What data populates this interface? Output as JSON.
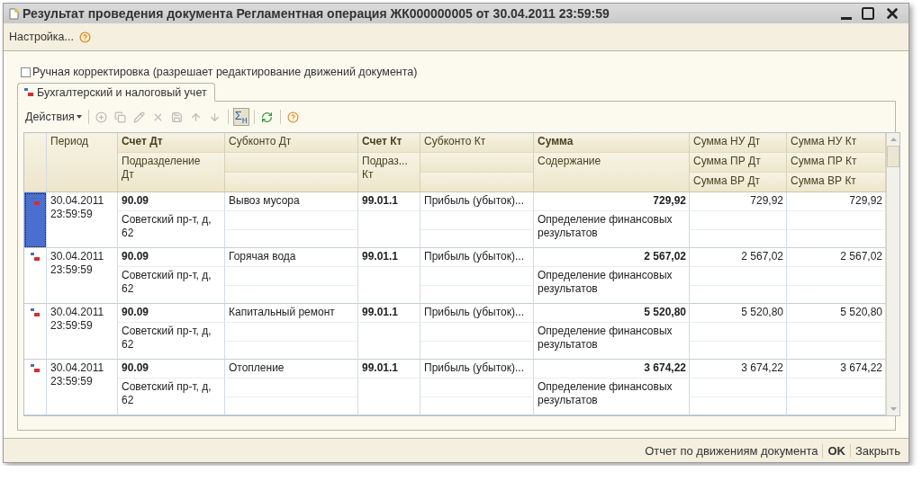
{
  "window": {
    "title": "Результат проведения документа Регламентная операция ЖК000000005 от 30.04.2011 23:59:59"
  },
  "menu": {
    "settings": "Настройка..."
  },
  "manual_correction": {
    "label": "Ручная корректировка (разрешает редактирование движений документа)",
    "checked": false
  },
  "tabs": [
    {
      "label": "Бухгалтерский и налоговый учет",
      "selected": true
    }
  ],
  "toolbar": {
    "actions": "Действия",
    "buttons": [
      {
        "kind": "add",
        "disabled": true,
        "pressed": false
      },
      {
        "kind": "copy",
        "disabled": true,
        "pressed": false
      },
      {
        "kind": "edit",
        "disabled": true,
        "pressed": false
      },
      {
        "kind": "delete",
        "disabled": true,
        "pressed": false
      },
      {
        "kind": "save",
        "disabled": true,
        "pressed": false
      },
      {
        "kind": "up",
        "disabled": true,
        "pressed": false
      },
      {
        "kind": "down",
        "disabled": true,
        "pressed": false
      },
      {
        "kind": "sum",
        "label": "Σ$_{н}$",
        "disabled": false,
        "pressed": true
      },
      {
        "kind": "refresh",
        "disabled": false,
        "pressed": false
      },
      {
        "kind": "help",
        "disabled": false,
        "pressed": false
      }
    ]
  },
  "table": {
    "columns": [
      {
        "kind": "span",
        "lines": [
          "Период"
        ]
      },
      {
        "kind": "pair",
        "bold": true,
        "lines": [
          "Счет Дт",
          "Подразделение\nДт"
        ]
      },
      {
        "kind": "triple",
        "lines": [
          "Субконто Дт"
        ]
      },
      {
        "kind": "pair",
        "bold": true,
        "lines": [
          "Счет Кт",
          "Подраз...\nКт"
        ]
      },
      {
        "kind": "triple",
        "lines": [
          "Субконто Кт"
        ]
      },
      {
        "kind": "pair",
        "bold": true,
        "numeric": true,
        "lines": [
          "Сумма",
          "Содержание"
        ]
      },
      {
        "kind": "triple",
        "numeric": true,
        "lines": [
          "Сумма НУ Дт",
          "Сумма ПР Дт",
          "Сумма ВР Дт"
        ]
      },
      {
        "kind": "triple",
        "numeric": true,
        "lines": [
          "Сумма НУ Кт",
          "Сумма ПР Кт",
          "Сумма ВР Кт"
        ]
      }
    ],
    "rows": [
      {
        "selected": true,
        "cells": [
          [
            "30.04.2011 23:59:59"
          ],
          [
            "90.09",
            "Советский пр-т, д, 62"
          ],
          [
            "Вывоз мусора"
          ],
          [
            "99.01.1"
          ],
          [
            "Прибыль (убыток)..."
          ],
          [
            "729,92",
            "Определение финансовых результатов"
          ],
          [
            "729,92"
          ],
          [
            "729,92"
          ]
        ]
      },
      {
        "selected": false,
        "cells": [
          [
            "30.04.2011 23:59:59"
          ],
          [
            "90.09",
            "Советский пр-т, д, 62"
          ],
          [
            "Горячая вода"
          ],
          [
            "99.01.1"
          ],
          [
            "Прибыль (убыток)..."
          ],
          [
            "2 567,02",
            "Определение финансовых результатов"
          ],
          [
            "2 567,02"
          ],
          [
            "2 567,02"
          ]
        ]
      },
      {
        "selected": false,
        "cells": [
          [
            "30.04.2011 23:59:59"
          ],
          [
            "90.09",
            "Советский пр-т, д, 62"
          ],
          [
            "Капитальный ремонт"
          ],
          [
            "99.01.1"
          ],
          [
            "Прибыль (убыток)..."
          ],
          [
            "5 520,80",
            "Определение финансовых результатов"
          ],
          [
            "5 520,80"
          ],
          [
            "5 520,80"
          ]
        ]
      },
      {
        "selected": false,
        "cells": [
          [
            "30.04.2011 23:59:59"
          ],
          [
            "90.09",
            "Советский пр-т, д, 62"
          ],
          [
            "Отопление"
          ],
          [
            "99.01.1"
          ],
          [
            "Прибыль (убыток)..."
          ],
          [
            "3 674,22",
            "Определение финансовых результатов"
          ],
          [
            "3 674,22"
          ],
          [
            "3 674,22"
          ]
        ]
      }
    ]
  },
  "footer": {
    "buttons": [
      {
        "label": "Отчет по движениям документа",
        "default": false
      },
      {
        "label": "OK",
        "default": true
      },
      {
        "label": "Закрыть",
        "default": false
      }
    ]
  }
}
